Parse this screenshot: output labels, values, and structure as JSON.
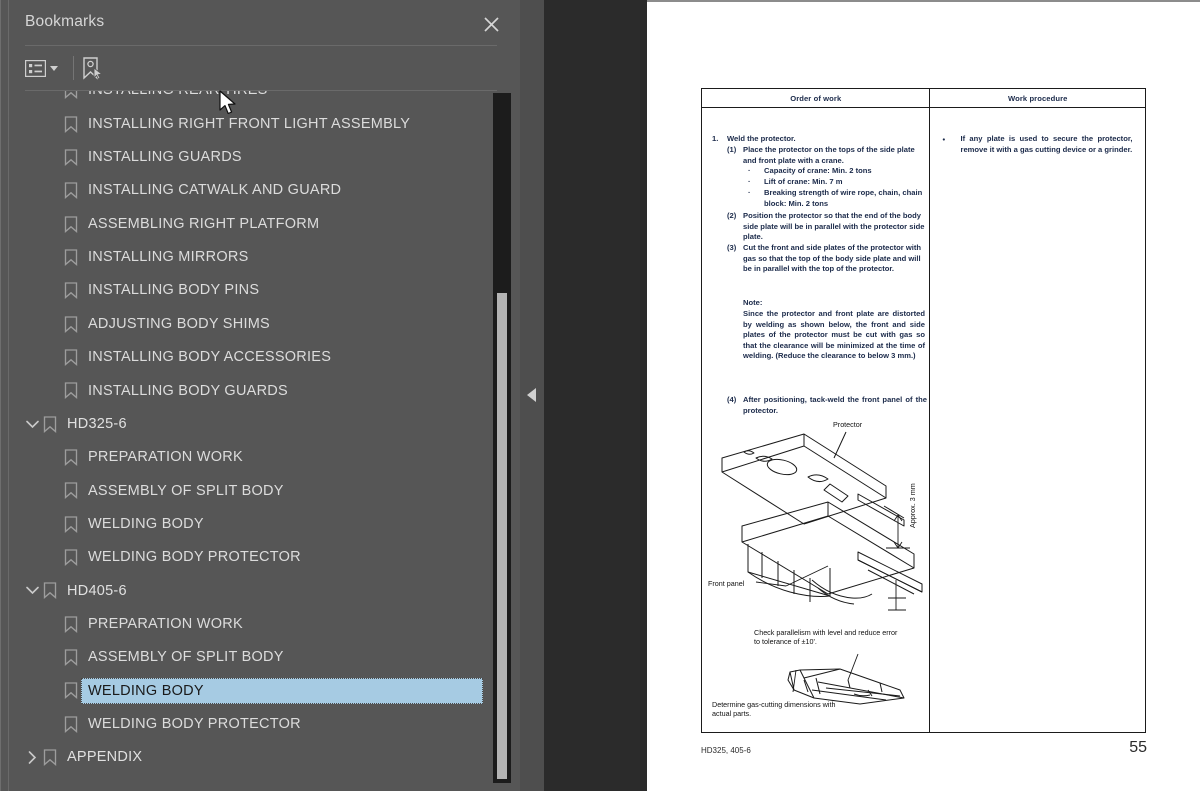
{
  "panel": {
    "title": "Bookmarks",
    "close_label": "×",
    "toolbar": {
      "options_icon": "list-options-icon",
      "options_caret": "chevron-down-icon",
      "new_bookmark_icon": "new-bookmark-icon"
    }
  },
  "bookmarks": [
    {
      "label": "INSTALLING REAR TIRES",
      "depth": 1,
      "expandable": false,
      "expanded": false,
      "selected": false
    },
    {
      "label": "INSTALLING RIGHT FRONT LIGHT ASSEMBLY",
      "depth": 1,
      "expandable": false,
      "expanded": false,
      "selected": false
    },
    {
      "label": "INSTALLING GUARDS",
      "depth": 1,
      "expandable": false,
      "expanded": false,
      "selected": false
    },
    {
      "label": "INSTALLING CATWALK AND GUARD",
      "depth": 1,
      "expandable": false,
      "expanded": false,
      "selected": false
    },
    {
      "label": "ASSEMBLING RIGHT PLATFORM",
      "depth": 1,
      "expandable": false,
      "expanded": false,
      "selected": false
    },
    {
      "label": "INSTALLING MIRRORS",
      "depth": 1,
      "expandable": false,
      "expanded": false,
      "selected": false
    },
    {
      "label": "INSTALLING BODY PINS",
      "depth": 1,
      "expandable": false,
      "expanded": false,
      "selected": false
    },
    {
      "label": "ADJUSTING BODY SHIMS",
      "depth": 1,
      "expandable": false,
      "expanded": false,
      "selected": false
    },
    {
      "label": "INSTALLING BODY ACCESSORIES",
      "depth": 1,
      "expandable": false,
      "expanded": false,
      "selected": false
    },
    {
      "label": "INSTALLING BODY GUARDS",
      "depth": 1,
      "expandable": false,
      "expanded": false,
      "selected": false
    },
    {
      "label": "HD325-6",
      "depth": 0,
      "expandable": true,
      "expanded": true,
      "selected": false
    },
    {
      "label": "PREPARATION WORK",
      "depth": 1,
      "expandable": false,
      "expanded": false,
      "selected": false
    },
    {
      "label": "ASSEMBLY OF SPLIT BODY",
      "depth": 1,
      "expandable": false,
      "expanded": false,
      "selected": false
    },
    {
      "label": "WELDING BODY",
      "depth": 1,
      "expandable": false,
      "expanded": false,
      "selected": false
    },
    {
      "label": "WELDING BODY PROTECTOR",
      "depth": 1,
      "expandable": false,
      "expanded": false,
      "selected": false
    },
    {
      "label": "HD405-6",
      "depth": 0,
      "expandable": true,
      "expanded": true,
      "selected": false
    },
    {
      "label": "PREPARATION WORK",
      "depth": 1,
      "expandable": false,
      "expanded": false,
      "selected": false
    },
    {
      "label": "ASSEMBLY OF SPLIT BODY",
      "depth": 1,
      "expandable": false,
      "expanded": false,
      "selected": false
    },
    {
      "label": "WELDING BODY",
      "depth": 1,
      "expandable": false,
      "expanded": false,
      "selected": true
    },
    {
      "label": "WELDING BODY PROTECTOR",
      "depth": 1,
      "expandable": false,
      "expanded": false,
      "selected": false
    },
    {
      "label": "APPENDIX",
      "depth": 0,
      "expandable": true,
      "expanded": false,
      "selected": false
    }
  ],
  "viewer": {
    "collapse_handle_icon": "triangle-left-icon"
  },
  "document": {
    "table": {
      "headers": [
        "Order of work",
        "Work procedure"
      ],
      "left_column": {
        "step_number": "1.",
        "step_title": "Weld the protector.",
        "substeps": [
          {
            "marker": "(1)",
            "text": "Place the protector on the tops of the side plate and front plate with a crane.",
            "bullets": [
              "Capacity of crane: Min. 2 tons",
              "Lift of crane: Min. 7 m",
              "Breaking strength of wire rope, chain, chain block: Min. 2 tons"
            ]
          },
          {
            "marker": "(2)",
            "text": "Position the protector so that the end of the body side plate will be in parallel with the protector side plate.",
            "bullets": []
          },
          {
            "marker": "(3)",
            "text": "Cut the front and side plates of the protector with gas so that the top of the body side plate and will be in parallel with the top of the protector.",
            "bullets": []
          },
          {
            "marker": "(4)",
            "text": "After positioning, tack-weld the front panel of the protector.",
            "bullets": []
          }
        ],
        "note_label": "Note:",
        "note_text": "Since the protector and front plate are distorted by welding as shown below, the front and side plates of the protector must be cut with gas so that the clearance will be minimized at the time of welding.  (Reduce the clearance to below 3 mm.)"
      },
      "right_column": {
        "bullet": "•",
        "text": "If any plate is used to secure the protector, remove it with a gas cutting device or a grinder."
      }
    },
    "figures": [
      {
        "name": "protector-assembly-diagram",
        "labels": {
          "protector": "Protector",
          "approx": "Approx. 3 mm",
          "front_panel": "Front panel"
        }
      },
      {
        "name": "parallelism-check-diagram",
        "labels": {
          "top": "Check parallelism with level and reduce error to tolerance of ±10'.",
          "bottom": "Determine gas-cutting dimensions with actual parts."
        }
      }
    ],
    "footer": {
      "left": "HD325, 405-6",
      "page_number": "55"
    }
  },
  "colors": {
    "panel_bg": "#565656",
    "viewer_bg": "#2b2b2b",
    "selection": "#a6cbe3",
    "doc_text": "#1b2a4a",
    "scrollbar_thumb": "#b4b4b4"
  }
}
